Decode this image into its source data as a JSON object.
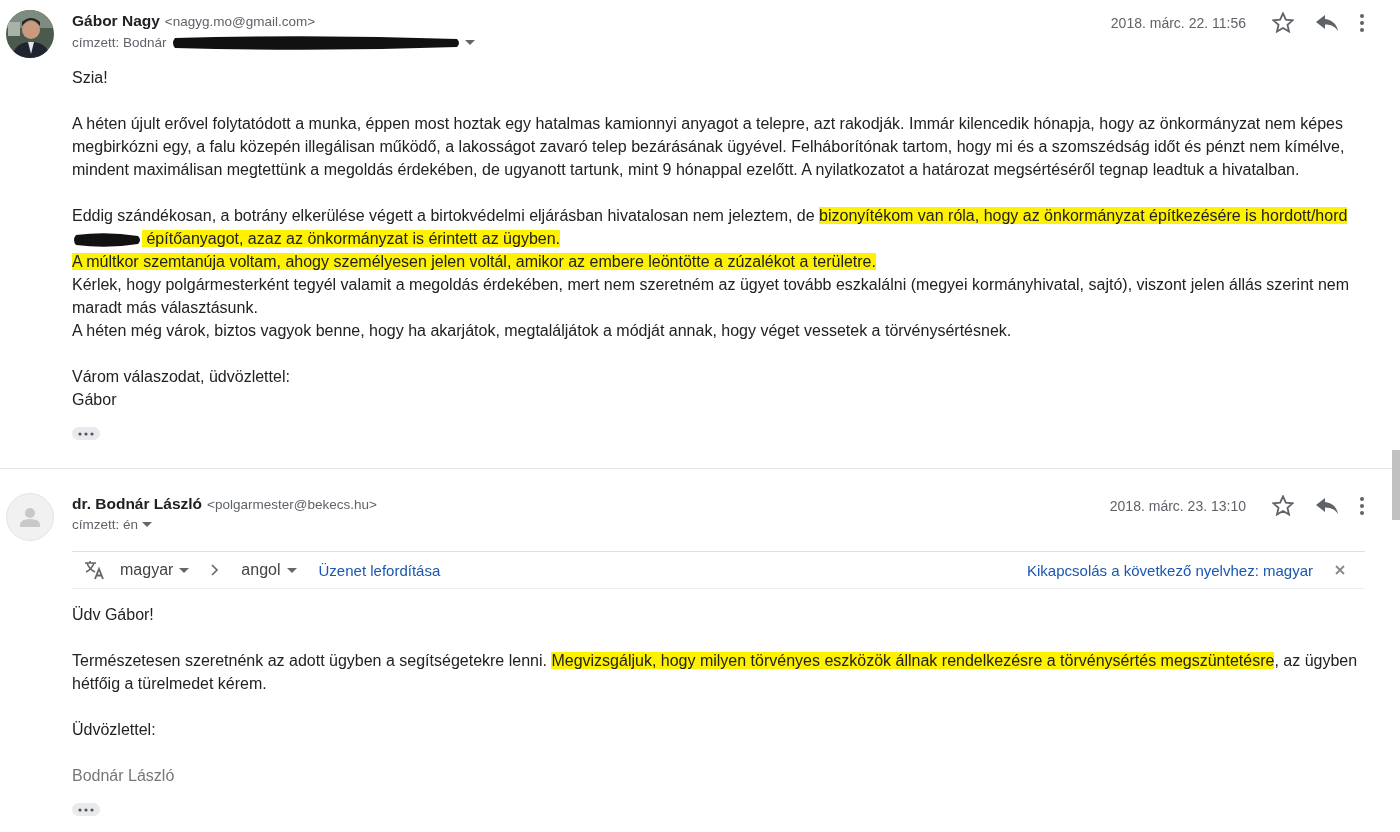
{
  "messages": [
    {
      "sender": "Gábor Nagy",
      "email": "<nagyg.mo@gmail.com>",
      "recipient": "címzett: Bodnár",
      "recipient_redacted": true,
      "date": "2018. márc. 22. 11:56",
      "starred": false,
      "paragraphs": [
        {
          "lines": [
            {
              "segments": [
                {
                  "kind": "text",
                  "text": "Szia!",
                  "highlighted": false
                }
              ]
            }
          ]
        },
        {
          "lines": [
            {
              "segments": [
                {
                  "kind": "text",
                  "text": "A héten újult erővel folytatódott a munka, éppen most hoztak egy hatalmas kamionnyi anyagot a telepre, azt rakodják. Immár kilencedik hónapja, hogy az önkormányzat nem képes megbirkózni egy, a falu közepén illegálisan működő, a lakosságot zavaró telep bezárásának ügyével. Felháborítónak tartom, hogy mi és a szomszédság időt és pénzt nem kímélve, mindent maximálisan megtettünk a megoldás érdekében, de ugyanott tartunk, mint 9 hónappal ezelőtt. A nyilatkozatot a határozat megsértéséről tegnap leadtuk a hivatalban.",
                  "highlighted": false
                }
              ]
            }
          ]
        },
        {
          "lines": [
            {
              "segments": [
                {
                  "kind": "text",
                  "text": "Eddig szándékosan, a botrány elkerülése végett a birtokvédelmi eljárásban hivatalosan nem jeleztem, de ",
                  "highlighted": false
                },
                {
                  "kind": "text",
                  "text": "bizonyítékom van róla, hogy az önkormányzat építkezésére is hordott/hord",
                  "highlighted": true
                },
                {
                  "kind": "redaction"
                },
                {
                  "kind": "text",
                  "text": " építőanyagot, azaz az önkormányzat is érintett az ügyben.",
                  "highlighted": true
                }
              ]
            },
            {
              "segments": [
                {
                  "kind": "text",
                  "text": "A múltkor szemtanúja voltam, ahogy személyesen jelen voltál, amikor az embere leöntötte a zúzalékot a területre.",
                  "highlighted": true
                }
              ]
            },
            {
              "segments": [
                {
                  "kind": "text",
                  "text": "Kérlek, hogy polgármesterként tegyél valamit a megoldás érdekében, mert nem szeretném az ügyet tovább eszkalálni (megyei kormányhivatal, sajtó), viszont jelen állás szerint nem maradt más választásunk.",
                  "highlighted": false
                }
              ]
            },
            {
              "segments": [
                {
                  "kind": "text",
                  "text": "A héten még várok, biztos vagyok benne, hogy ha akarjátok, megtaláljátok a módját annak, hogy véget vessetek a törvénysértésnek.",
                  "highlighted": false
                }
              ]
            }
          ]
        },
        {
          "lines": [
            {
              "segments": [
                {
                  "kind": "text",
                  "text": "Várom válaszodat, üdvözlettel:",
                  "highlighted": false
                }
              ]
            },
            {
              "segments": [
                {
                  "kind": "text",
                  "text": "Gábor",
                  "highlighted": false
                }
              ]
            }
          ]
        }
      ]
    },
    {
      "sender": "dr. Bodnár László",
      "email": "<polgarmester@bekecs.hu>",
      "recipient": "címzett: én",
      "recipient_redacted": false,
      "date": "2018. márc. 23. 13:10",
      "starred": false,
      "avatar": {
        "kind": "silhouette"
      },
      "translation": {
        "from": "magyar",
        "to": "angol",
        "action": "Üzenet lefordítása",
        "disable": "Kikapcsolás a következő nyelvhez: magyar"
      },
      "paragraphs": [
        {
          "lines": [
            {
              "segments": [
                {
                  "kind": "text",
                  "text": "Üdv Gábor!",
                  "highlighted": false
                }
              ]
            }
          ]
        },
        {
          "lines": [
            {
              "segments": [
                {
                  "kind": "text",
                  "text": "Természetesen szeretnénk az adott ügyben a segítségetekre lenni. ",
                  "highlighted": false
                },
                {
                  "kind": "text",
                  "text": "Megvizsgáljuk, hogy milyen törvényes eszközök állnak rendelkezésre a törvénysértés megszüntetésre",
                  "highlighted": true
                },
                {
                  "kind": "text",
                  "text": ", az ügyben hétfőig a türelmedet kérem.",
                  "highlighted": false
                }
              ]
            }
          ]
        },
        {
          "lines": [
            {
              "segments": [
                {
                  "kind": "text",
                  "text": "Üdvözlettel:",
                  "highlighted": false
                }
              ]
            }
          ]
        },
        {
          "lines": [
            {
              "segments": [
                {
                  "kind": "signature",
                  "text": "Bodnár László",
                  "highlighted": false
                }
              ]
            }
          ]
        }
      ]
    }
  ]
}
